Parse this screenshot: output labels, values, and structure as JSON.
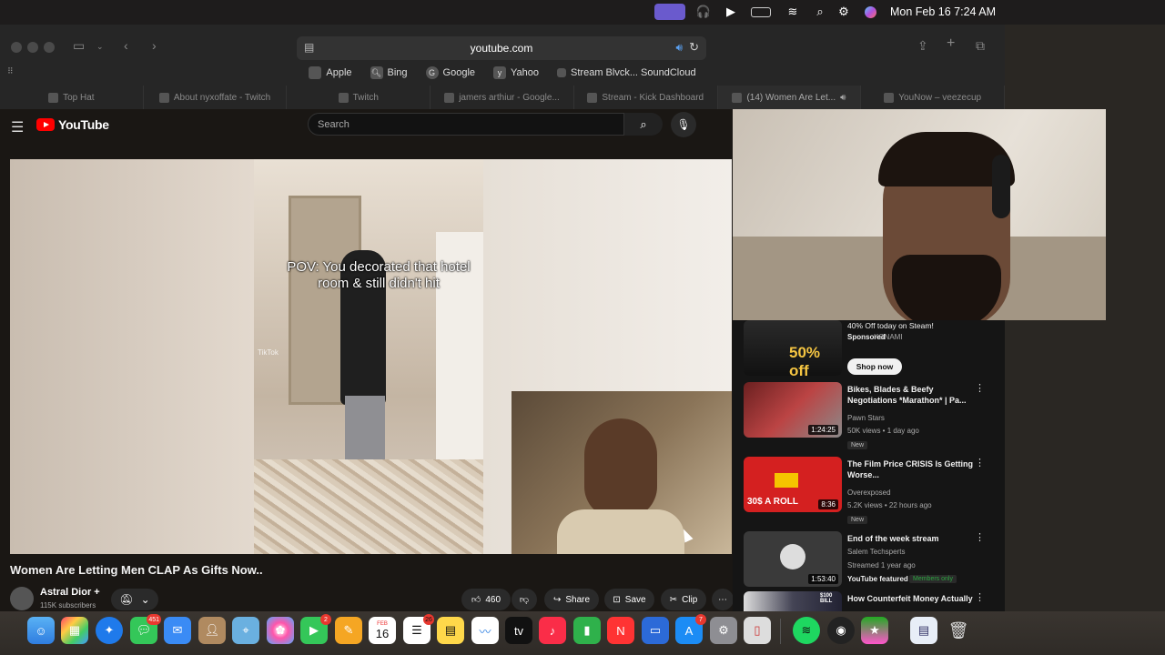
{
  "menubar": {
    "datetime": "Mon Feb 16  7:24 AM"
  },
  "browser": {
    "url": "youtube.com",
    "favorites": [
      "Apple",
      "Bing",
      "Google",
      "Yahoo",
      "Stream Blvck... SoundCloud"
    ],
    "tabs": [
      "Top Hat",
      "About nyxoffate - Twitch",
      "Twitch",
      "jamers arthiur - Google...",
      "Stream - Kick Dashboard",
      "(14) Women Are Let...",
      "YouNow – veezecup"
    ]
  },
  "youtube": {
    "logo": "YouTube",
    "search_placeholder": "Search",
    "video": {
      "caption": "POV: You decorated that hotel room & still didn't hit",
      "tiktok": "TikTok",
      "title": "Women Are Letting Men CLAP As Gifts Now..",
      "channel": "Astral Dior +",
      "subs": "115K subscribers",
      "likes": "460",
      "share": "Share",
      "save": "Save",
      "clip": "Clip"
    },
    "sidebar": {
      "ad": {
        "title": "40% Off today on Steam!",
        "sponsored": "Sponsored",
        "advertiser": "KONAMI",
        "cta": "Shop now",
        "thumb_text": "50% off"
      },
      "items": [
        {
          "title": "Bikes, Blades & Beefy Negotiations *Marathon* | Pa...",
          "channel": "Pawn Stars",
          "meta": "50K views • 1 day ago",
          "badge": "New",
          "duration": "1:24:25"
        },
        {
          "title": "The Film Price CRISIS Is Getting Worse...",
          "channel": "Overexposed",
          "meta": "5.2K views • 22 hours ago",
          "badge": "New",
          "duration": "8:36",
          "thumb_text": "30$ A ROLL"
        },
        {
          "title": "End of the week stream",
          "channel": "Salem Techsperts",
          "meta": "Streamed 1 year ago",
          "badge": "YouTube featured",
          "badge2": "Members only",
          "duration": "1:53:40"
        },
        {
          "title": "How Counterfeit Money Actually",
          "thumb_text": "$100 BILL"
        }
      ]
    }
  },
  "dock": {
    "badges": {
      "messages": "451",
      "facetime": "2",
      "calendar": "26",
      "appstore": "7",
      "calendar_day": "16",
      "calendar_month": "FEB"
    }
  },
  "colors": {
    "yt_red": "#ff0000",
    "members": "#2ba640"
  }
}
